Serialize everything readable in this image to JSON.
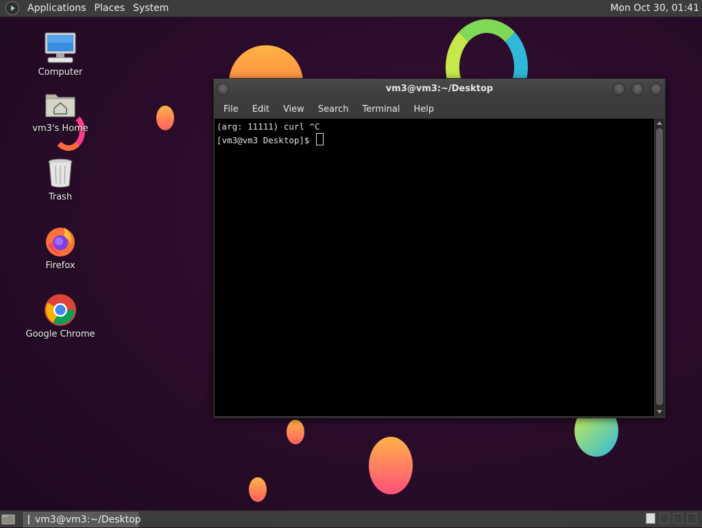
{
  "top_panel": {
    "menus": [
      "Applications",
      "Places",
      "System"
    ],
    "clock": "Mon Oct 30, 01:41"
  },
  "desktop_icons": [
    {
      "label": "Computer",
      "icon": "computer-icon"
    },
    {
      "label": "vm3's Home",
      "icon": "home-folder-icon"
    },
    {
      "label": "Trash",
      "icon": "trash-icon"
    },
    {
      "label": "Firefox",
      "icon": "firefox-icon"
    },
    {
      "label": "Google Chrome",
      "icon": "chrome-icon"
    }
  ],
  "terminal": {
    "title": "vm3@vm3:~/Desktop",
    "menu": [
      "File",
      "Edit",
      "View",
      "Search",
      "Terminal",
      "Help"
    ],
    "lines": [
      "(arg: 11111) curl ^C",
      "[vm3@vm3 Desktop]$ "
    ]
  },
  "taskbar": {
    "task_label": "vm3@vm3:~/Desktop"
  },
  "colors": {
    "panel": "#3c3c3c",
    "desktop": "#2a0c2a",
    "terminal_bg": "#000000"
  }
}
